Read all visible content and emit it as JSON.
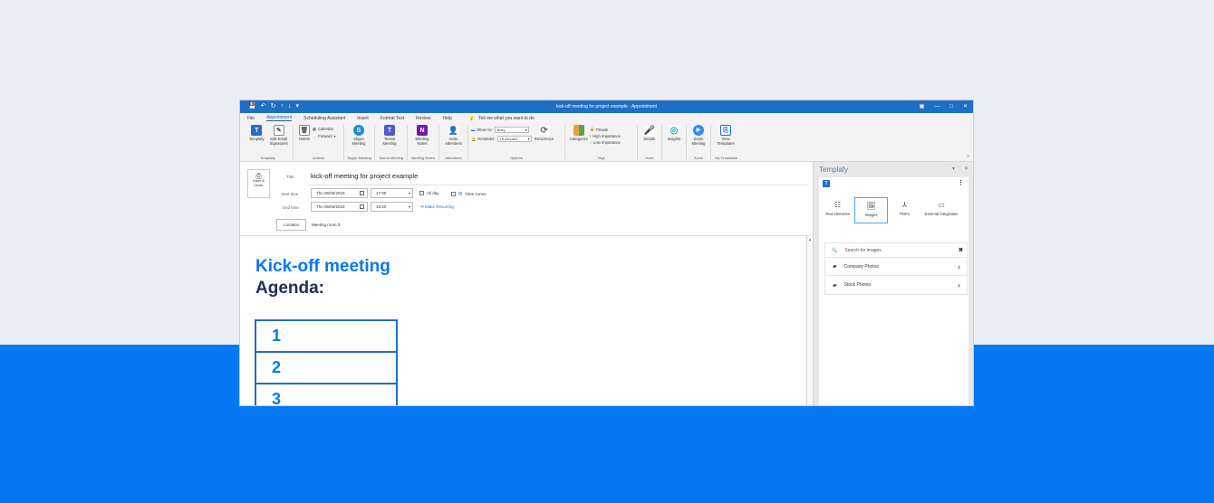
{
  "window": {
    "title": "kick-off meeting for project example  -  Appointment",
    "quick_access": [
      "💾",
      "↶",
      "↻",
      "↑",
      "↓",
      "▾"
    ],
    "controls": [
      "▣",
      "—",
      "□",
      "✕"
    ]
  },
  "menu": {
    "items": [
      "File",
      "Appointment",
      "Scheduling Assistant",
      "Insert",
      "Format Text",
      "Review",
      "Help"
    ],
    "active_index": 1,
    "tell_me": "Tell me what you want to do"
  },
  "ribbon": {
    "templafy": {
      "label": "Templafy",
      "edit_email": "Edit Email Signatures",
      "group": "Templafy"
    },
    "actions": {
      "delete": "Delete",
      "calendar": "Calendar",
      "forward": "Forward",
      "group": "Actions"
    },
    "skype": {
      "label": "Skype Meeting",
      "group": "Skype Meeting"
    },
    "teams": {
      "label": "Teams Meeting",
      "group": "Teams Meeting"
    },
    "notes": {
      "label": "Meeting Notes",
      "group": "Meeting Notes"
    },
    "attendees": {
      "label": "Invite Attendees",
      "group": "Attendees"
    },
    "options": {
      "show_as": "Show As:",
      "show_as_value": "Busy",
      "reminder": "Reminder:",
      "reminder_value": "15 minutes",
      "recurrence": "Recurrence",
      "group": "Options"
    },
    "tags": {
      "categorize": "Categorize",
      "private": "Private",
      "high": "High Importance",
      "low": "Low Importance",
      "group": "Tags"
    },
    "voice": {
      "dictate": "Dictate",
      "group": "Voice"
    },
    "insights": {
      "label": "Insights"
    },
    "zoom": {
      "label": "Zoom Meeting",
      "group": "Zoom"
    },
    "my_templates": {
      "label": "View Templates",
      "group": "My Templates"
    }
  },
  "form": {
    "save_close": "Save & Close",
    "title_label": "Title",
    "title_value": "kick-off meeting for project example",
    "start_label": "Start time",
    "start_date": "Thu 06/06/2019",
    "start_time": "17:00",
    "all_day": "All day",
    "time_zones": "Time zones",
    "end_label": "End time",
    "end_date": "Thu 06/06/2019",
    "end_time": "19:30",
    "make_recurring": "Make Recurring",
    "location_btn": "Location",
    "location_value": "Meeting room 3"
  },
  "body": {
    "heading_line1": "Kick-off meeting",
    "heading_line2": "Agenda:",
    "agenda_items": [
      "1",
      "2",
      "3"
    ]
  },
  "pane": {
    "title": "Templafy",
    "tabs": [
      "Text elements",
      "Images",
      "PDFs",
      "External integration"
    ],
    "active_tab": 1,
    "search_placeholder": "Search for images",
    "folders": [
      "Company Photos",
      "Stock Photos"
    ]
  },
  "colors": {
    "accent": "#0677f3",
    "heading_dark": "#1f2d5c",
    "titlebar": "#1f6fc6"
  }
}
